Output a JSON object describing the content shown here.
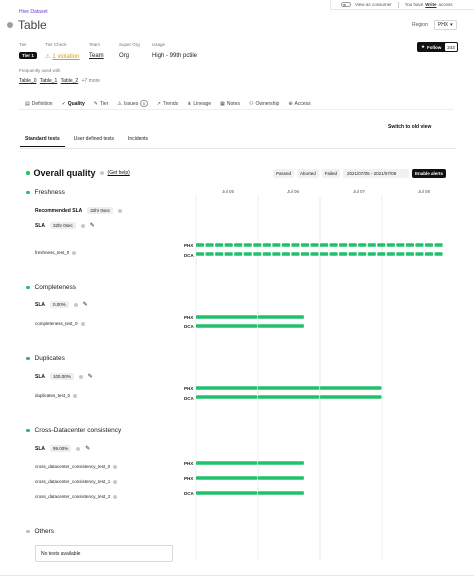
{
  "topbar": {
    "view_as_label": "View as consumer",
    "access_prefix": "You have",
    "access_link": "Write",
    "access_suffix": "access"
  },
  "breadcrumb": "Hive Dataset",
  "title": "Table",
  "region": {
    "label": "Region",
    "value": "PHX"
  },
  "follow": {
    "label": "Follow",
    "count": "243"
  },
  "meta": {
    "tier_label": "Tier",
    "tier_value": "Tier 1",
    "tier_check_label": "Tier Check",
    "tier_check_value": "1 violation",
    "team_label": "Team",
    "team_value": "Team",
    "super_org_label": "Super Org",
    "super_org_value": "Org",
    "usage_label": "Usage",
    "usage_value": "High - 99th pctile",
    "frequently_used_label": "Frequently used with",
    "frequent_tables": [
      "Table_0",
      "Table_1",
      "Table_2"
    ],
    "more": "+7 more"
  },
  "tabs": [
    {
      "label": "Definition",
      "icon": "document-icon"
    },
    {
      "label": "Quality",
      "icon": "check-icon",
      "active": true
    },
    {
      "label": "Tier",
      "icon": "pen-icon"
    },
    {
      "label": "Issues",
      "icon": "alert-icon",
      "count": "0"
    },
    {
      "label": "Trends",
      "icon": "trend-icon"
    },
    {
      "label": "Lineage",
      "icon": "lineage-icon"
    },
    {
      "label": "Notes",
      "icon": "notes-icon"
    },
    {
      "label": "Ownership",
      "icon": "ownership-icon"
    },
    {
      "label": "Access",
      "icon": "access-icon"
    }
  ],
  "switch_old_view": "Switch to old view",
  "subtabs": [
    "Standard tests",
    "User defined tests",
    "Incidents"
  ],
  "overall": {
    "title": "Overall quality",
    "help": "(Get help)",
    "filters": [
      "Passed",
      "Aborted",
      "Failed"
    ],
    "date_range": "2021/07/05 - 2021/07/08",
    "enable_alerts": "Enable alerts"
  },
  "timeline": {
    "ticks": [
      "Jul 05",
      "Jul 06",
      "Jul 07",
      "Jul 08"
    ]
  },
  "sections": {
    "freshness": {
      "title": "Freshness",
      "recommended_sla_label": "Recommended SLA",
      "recommended_sla_value": "32hr 0sec",
      "sla_label": "SLA",
      "sla_value": "32hr 0sec",
      "tests": [
        "freshness_test_0"
      ]
    },
    "completeness": {
      "title": "Completeness",
      "sla_label": "SLA",
      "sla_value": "0.00%",
      "tests": [
        "completeness_test_0"
      ]
    },
    "duplicates": {
      "title": "Duplicates",
      "sla_label": "SLA",
      "sla_value": "100.00%",
      "tests": [
        "duplicates_test_0"
      ]
    },
    "consistency": {
      "title": "Cross-Datacenter consistency",
      "sla_label": "SLA",
      "sla_value": "99.00%",
      "tests": [
        "cross_datacenter_consistency_test_0",
        "cross_datacenter_consistency_test_1",
        "cross_datacenter_consistency_test_2"
      ]
    },
    "others": {
      "title": "Others",
      "empty_text": "No tests available"
    }
  },
  "row_labels": {
    "phx": "PHX",
    "dca": "DCA"
  },
  "status_rows": [
    {
      "section": "freshness",
      "dc": "PHX",
      "status": "passed",
      "start": "2021-07-05",
      "end": "2021-07-09",
      "segmented": true
    },
    {
      "section": "freshness",
      "dc": "DCA",
      "status": "passed",
      "start": "2021-07-05",
      "end": "2021-07-09",
      "segmented": true
    },
    {
      "section": "completeness",
      "dc": "PHX",
      "status": "passed",
      "start": "2021-07-05",
      "end": "2021-07-06 18:00"
    },
    {
      "section": "completeness",
      "dc": "DCA",
      "status": "passed",
      "start": "2021-07-05",
      "end": "2021-07-06 18:00"
    },
    {
      "section": "duplicates",
      "dc": "PHX",
      "status": "passed",
      "start": "2021-07-05",
      "end": "2021-07-08"
    },
    {
      "section": "duplicates",
      "dc": "DCA",
      "status": "passed",
      "start": "2021-07-05",
      "end": "2021-07-08"
    },
    {
      "section": "consistency",
      "dc": "PHX",
      "status": "passed",
      "start": "2021-07-05",
      "end": "2021-07-06 18:00"
    },
    {
      "section": "consistency",
      "dc": "PHX",
      "status": "passed",
      "start": "2021-07-05",
      "end": "2021-07-06 18:00"
    },
    {
      "section": "consistency",
      "dc": "DCA",
      "status": "passed",
      "start": "2021-07-05",
      "end": "2021-07-06 18:00"
    }
  ],
  "colors": {
    "passed": "#21c16b",
    "accent": "#6b3fc4",
    "violation": "#d4a017"
  }
}
